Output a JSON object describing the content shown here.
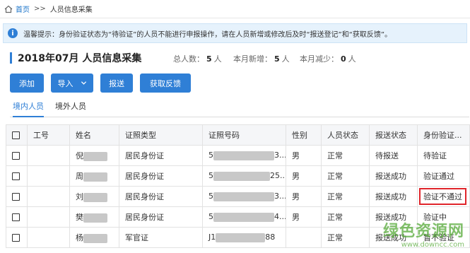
{
  "breadcrumb": {
    "home": "首页",
    "separator": ">>",
    "current": "人员信息采集"
  },
  "notice": {
    "icon": "info-icon",
    "text": "温馨提示：身份验证状态为“待验证”的人员不能进行申报操作，请在人员新增或修改后及时“报送登记”和“获取反馈”。"
  },
  "header": {
    "title": "2018年07月  人员信息采集",
    "accent_color": "#2f7fd6"
  },
  "stats": [
    {
      "label": "总人数：",
      "value": "5",
      "unit": "人"
    },
    {
      "label": "本月新增：",
      "value": "5",
      "unit": "人"
    },
    {
      "label": "本月减少：",
      "value": "0",
      "unit": "人"
    }
  ],
  "toolbar": {
    "add": "添加",
    "import": "导入",
    "submit": "报送",
    "feedback": "获取反馈"
  },
  "tabs": [
    {
      "label": "境内人员",
      "active": true
    },
    {
      "label": "境外人员",
      "active": false
    }
  ],
  "table": {
    "headers": [
      "工号",
      "姓名",
      "证照类型",
      "证照号码",
      "性别",
      "人员状态",
      "报送状态",
      "身份验证..."
    ],
    "rows": [
      {
        "name": "倪",
        "id_type": "居民身份证",
        "id_prefix": "5",
        "id_suffix": "3...",
        "gender": "男",
        "status": "正常",
        "report": "待报送",
        "verify": "待验证",
        "highlight": false
      },
      {
        "name": "周",
        "id_type": "居民身份证",
        "id_prefix": "5",
        "id_suffix": "25...",
        "gender": "男",
        "status": "正常",
        "report": "报送成功",
        "verify": "验证通过",
        "highlight": false
      },
      {
        "name": "刘",
        "id_type": "居民身份证",
        "id_prefix": "5",
        "id_suffix": "3...",
        "gender": "男",
        "status": "正常",
        "report": "报送成功",
        "verify": "验证不通过",
        "highlight": true
      },
      {
        "name": "樊",
        "id_type": "居民身份证",
        "id_prefix": "5",
        "id_suffix": "4...",
        "gender": "男",
        "status": "正常",
        "report": "报送成功",
        "verify": "验证中",
        "highlight": false
      },
      {
        "name": "杨",
        "id_type": "军官证",
        "id_prefix": "J1",
        "id_suffix": "88",
        "gender": "",
        "status": "正常",
        "report": "报送成功",
        "verify": "暂不验证",
        "highlight": false
      }
    ]
  },
  "watermark": {
    "title": "绿色资源网",
    "url": "www.downcc.com"
  }
}
